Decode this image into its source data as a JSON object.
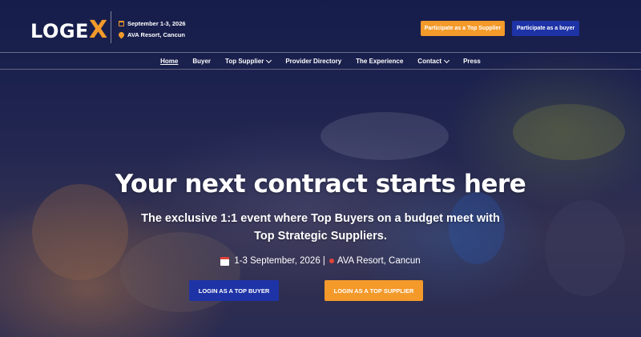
{
  "header": {
    "logo": {
      "text": "LOGE",
      "accent": "X"
    },
    "event_date": "September 1-3, 2026",
    "event_location": "AVA Resort, Cancun",
    "cta_supplier": "Participate as a Top Supplier",
    "cta_buyer": "Participate as a buyer"
  },
  "nav": {
    "items": [
      {
        "label": "Home",
        "active": true,
        "dropdown": false
      },
      {
        "label": "Buyer",
        "dropdown": false
      },
      {
        "label": "Top Supplier",
        "dropdown": true
      },
      {
        "label": "Provider Directory",
        "dropdown": false
      },
      {
        "label": "The Experience",
        "dropdown": false
      },
      {
        "label": "Contact",
        "dropdown": true
      },
      {
        "label": "Press",
        "dropdown": false
      }
    ]
  },
  "hero": {
    "title": "Your next contract starts here",
    "subtitle_line1": "The exclusive 1:1 event where Top Buyers on a budget meet with",
    "subtitle_line2": "Top Strategic Suppliers.",
    "dates": "1-3 September, 2026 |",
    "location": "AVA Resort, Cancun",
    "login_buyer": "LOGIN AS A TOP BUYER",
    "login_supplier": "LOGIN AS A TOP SUPPLIER"
  },
  "colors": {
    "accent_orange": "#f39a2b",
    "primary_blue": "#1e33a6",
    "background": "#1c2350"
  }
}
